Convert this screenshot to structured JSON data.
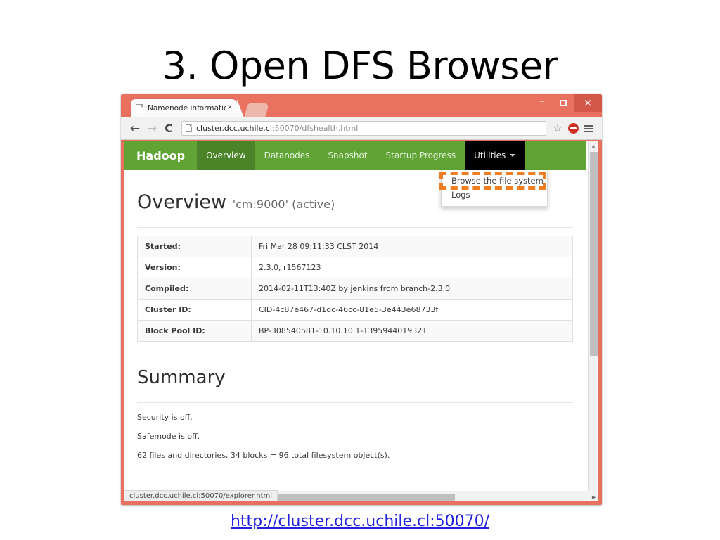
{
  "slide": {
    "title": "3. Open DFS Browser",
    "link": "http://cluster.dcc.uchile.cl:50070/"
  },
  "browser": {
    "window_controls": {
      "minimize": "–",
      "maximize": "",
      "close": "×"
    },
    "tab": {
      "title": "Namenode information",
      "close": "×"
    },
    "toolbar": {
      "back": "←",
      "forward": "→",
      "reload": "C",
      "url_host": "cluster.dcc.uchile.cl",
      "url_path": ":50070/dfshealth.html",
      "bookmark_star": "☆"
    },
    "status_bubble": "cluster.dcc.uchile.cl:50070/explorer.html"
  },
  "hadoop": {
    "brand": "Hadoop",
    "nav": [
      {
        "label": "Overview",
        "state": "active"
      },
      {
        "label": "Datanodes",
        "state": "normal"
      },
      {
        "label": "Snapshot",
        "state": "normal"
      },
      {
        "label": "Startup Progress",
        "state": "normal"
      },
      {
        "label": "Utilities",
        "state": "open"
      }
    ],
    "dropdown": {
      "items": [
        "Browse the file system",
        "Logs"
      ],
      "highlighted_index": 0,
      "highlight_color": "#ef7d22"
    },
    "overview": {
      "heading": "Overview",
      "subheading": "'cm:9000' (active)",
      "rows": [
        {
          "key": "Started:",
          "value": "Fri Mar 28 09:11:33 CLST 2014"
        },
        {
          "key": "Version:",
          "value": "2.3.0, r1567123"
        },
        {
          "key": "Compiled:",
          "value": "2014-02-11T13:40Z by jenkins from branch-2.3.0"
        },
        {
          "key": "Cluster ID:",
          "value": "CID-4c87e467-d1dc-46cc-81e5-3e443e68733f"
        },
        {
          "key": "Block Pool ID:",
          "value": "BP-308540581-10.10.10.1-1395944019321"
        }
      ]
    },
    "summary": {
      "heading": "Summary",
      "lines": [
        "Security is off.",
        "Safemode is off.",
        "62 files and directories, 34 blocks = 96 total filesystem object(s)."
      ]
    }
  },
  "colors": {
    "window_chrome": "#e8715f",
    "hadoop_green": "#5fa434",
    "hadoop_green_active": "#4b8328",
    "link_blue": "#2222dd"
  }
}
